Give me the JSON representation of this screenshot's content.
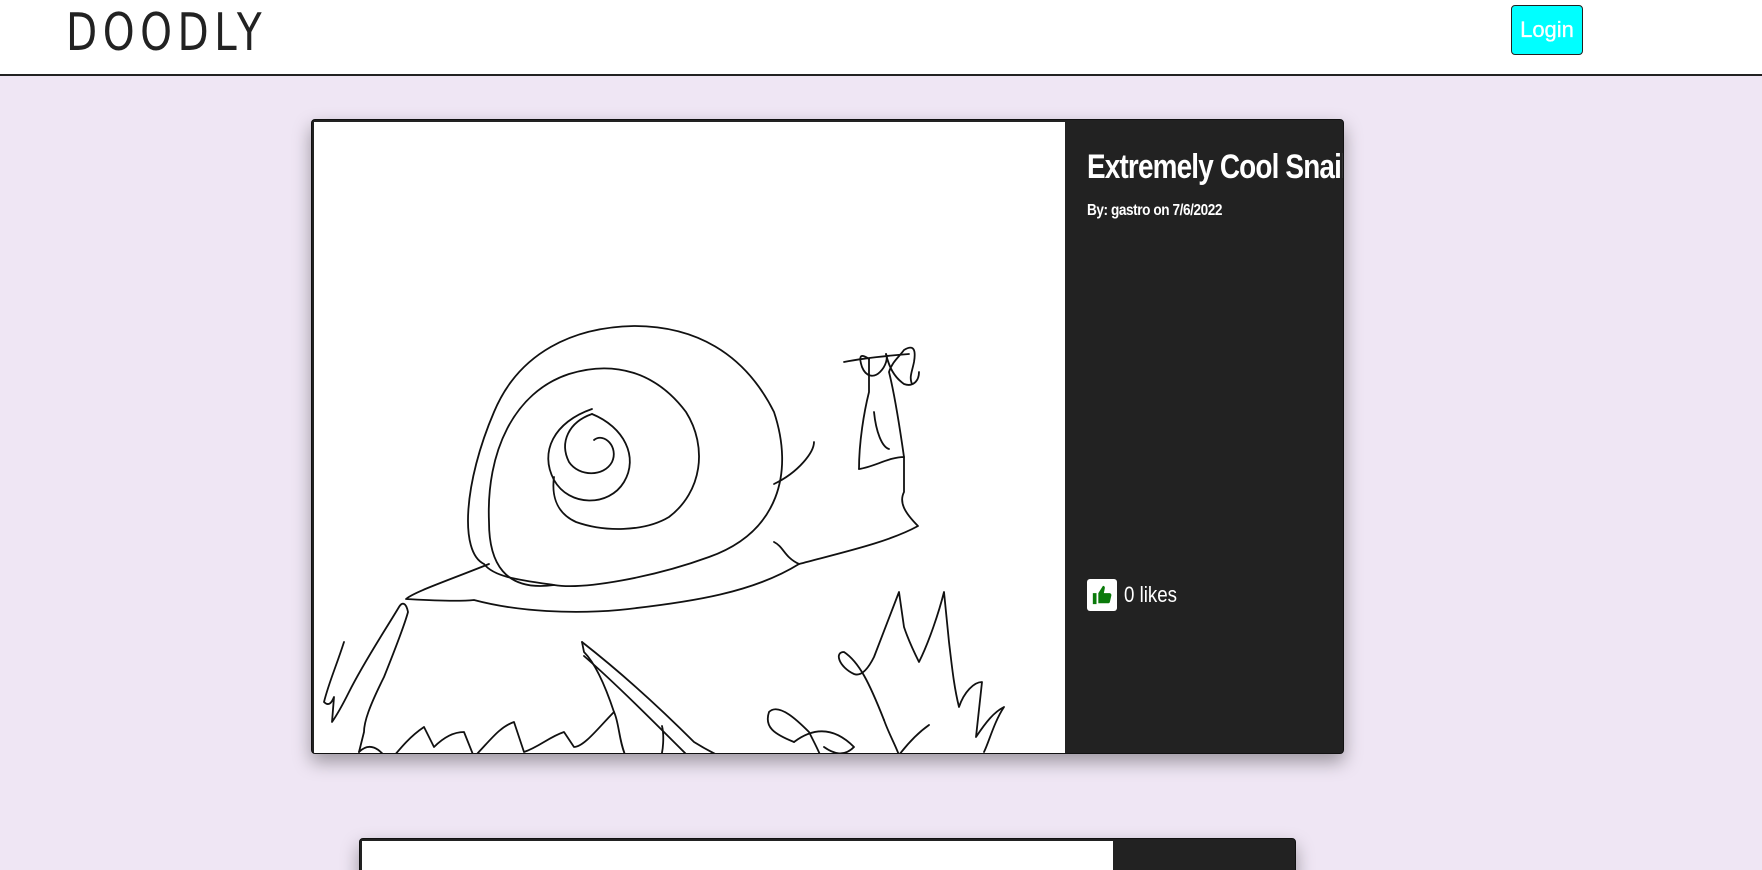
{
  "brand": "DOODLY",
  "nav": {
    "login_label": "Login"
  },
  "colors": {
    "background": "#efe6f4",
    "login_button": "#00ffff",
    "card_info": "#222222",
    "like_icon": "#0a7a0a"
  },
  "post": {
    "title": "Extremely Cool Snail",
    "byline": "By: gastro on 7/6/2022",
    "likes_text": "0 likes",
    "like_icon": "thumbs-up-icon",
    "image": "snail-doodle"
  }
}
